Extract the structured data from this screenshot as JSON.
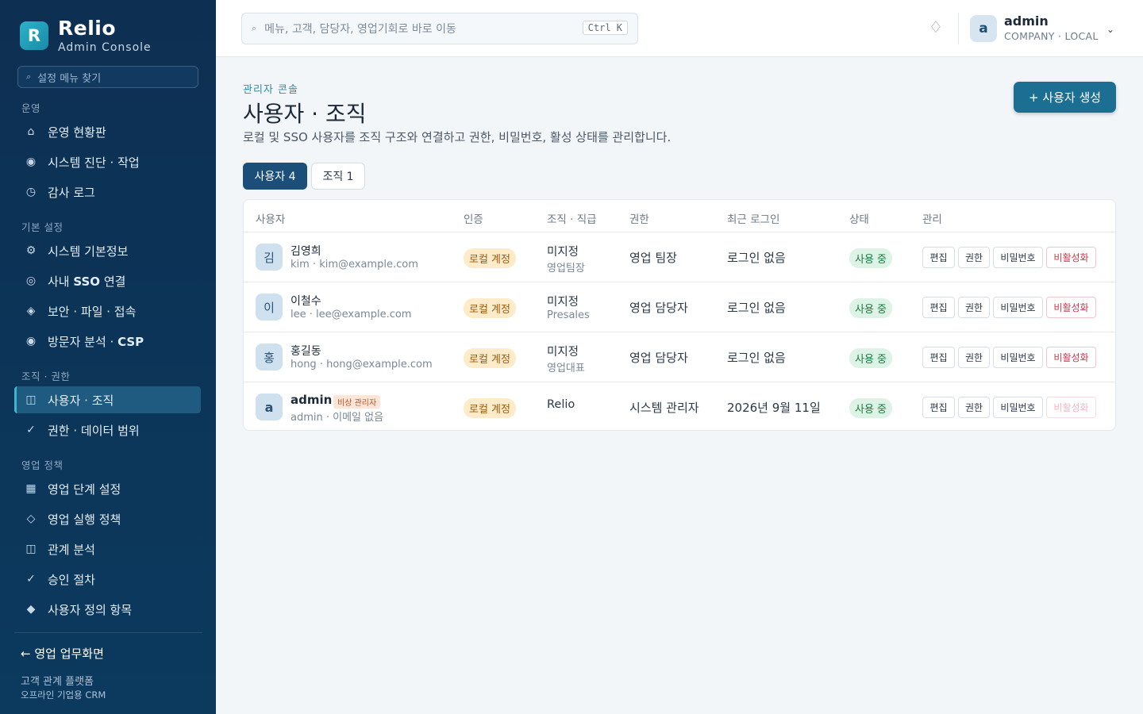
{
  "brand": {
    "logo": "R",
    "name": "Relio",
    "subtitle": "Admin Console"
  },
  "sidebar": {
    "search_placeholder": "설정 메뉴 찾기",
    "sections": [
      {
        "label": "운영",
        "items": [
          {
            "icon": "home-icon",
            "glyph": "⌂",
            "label": "운영 현황판"
          },
          {
            "icon": "diagnostics-icon",
            "glyph": "◉",
            "label": "시스템 진단 · 작업"
          },
          {
            "icon": "clock-icon",
            "glyph": "◷",
            "label": "감사 로그"
          }
        ]
      },
      {
        "label": "기본 설정",
        "items": [
          {
            "icon": "gear-icon",
            "glyph": "⚙",
            "label": "시스템 기본정보"
          },
          {
            "icon": "sso-icon",
            "glyph": "◎",
            "label_pre": "사내 ",
            "label_bold": "SSO",
            "label_post": " 연결"
          },
          {
            "icon": "security-icon",
            "glyph": "◈",
            "label": "보안 · 파일 · 접속"
          },
          {
            "icon": "analytics-icon",
            "glyph": "◉",
            "label_pre": "방문자 분석 · ",
            "label_bold": "CSP",
            "label_post": ""
          }
        ]
      },
      {
        "label": "조직 · 권한",
        "items": [
          {
            "icon": "users-icon",
            "glyph": "◫",
            "label": "사용자 · 조직",
            "active": true
          },
          {
            "icon": "check-icon",
            "glyph": "✓",
            "label": "권한 · 데이터 범위"
          }
        ]
      },
      {
        "label": "영업 정책",
        "items": [
          {
            "icon": "grid-icon",
            "glyph": "▦",
            "label": "영업 단계 설정"
          },
          {
            "icon": "diamond-outline-icon",
            "glyph": "◇",
            "label": "영업 실행 정책"
          },
          {
            "icon": "relation-icon",
            "glyph": "◫",
            "label": "관계 분석"
          },
          {
            "icon": "check-icon",
            "glyph": "✓",
            "label": "승인 절차"
          },
          {
            "icon": "diamond-icon",
            "glyph": "◆",
            "label": "사용자 정의 항목"
          }
        ]
      }
    ],
    "back_link": "← 영업 업무화면",
    "footer_line1": "고객 관계 플랫폼",
    "footer_line2": "오프라인 기업용 CRM"
  },
  "topbar": {
    "search_placeholder": "메뉴, 고객, 담당자, 영업기회로 바로 이동",
    "shortcut": "Ctrl K",
    "notify_glyph": "♢",
    "user": {
      "avatar": "a",
      "name": "admin",
      "meta": "COMPANY · LOCAL",
      "caret": "⌄"
    }
  },
  "main": {
    "eyebrow": "관리자 콘솔",
    "title": "사용자 · 조직",
    "description": "로컬 및 SSO 사용자를 조직 구조와 연결하고 권한, 비밀번호, 활성 상태를 관리합니다.",
    "create_button": "+ 사용자 생성",
    "tabs": [
      {
        "label": "사용자 4",
        "active": true
      },
      {
        "label": "조직 1",
        "active": false
      }
    ],
    "table": {
      "headers": [
        "사용자",
        "인증",
        "조직 · 직급",
        "권한",
        "최근 로그인",
        "상태",
        "관리"
      ],
      "actions": [
        "편집",
        "권한",
        "비밀번호",
        "비활성화"
      ],
      "rows": [
        {
          "avatar": "김",
          "name": "김영희",
          "sub": "kim · kim@example.com",
          "auth": "로컬 계정",
          "org": "미지정",
          "position": "영업팀장",
          "role": "영업 팀장",
          "last_login": "로그인 없음",
          "status": "사용 중"
        },
        {
          "avatar": "이",
          "name": "이철수",
          "sub": "lee · lee@example.com",
          "auth": "로컬 계정",
          "org": "미지정",
          "position": "Presales",
          "role": "영업 담당자",
          "last_login": "로그인 없음",
          "status": "사용 중"
        },
        {
          "avatar": "홍",
          "name": "홍길동",
          "sub": "hong · hong@example.com",
          "auth": "로컬 계정",
          "org": "미지정",
          "position": "영업대표",
          "role": "영업 담당자",
          "last_login": "로그인 없음",
          "status": "사용 중"
        },
        {
          "avatar": "a",
          "name": "admin",
          "badge": "비상 관리자",
          "sub": "admin · 이메일 없음",
          "auth": "로컬 계정",
          "org": "Relio",
          "position": "",
          "role": "시스템 관리자",
          "last_login": "2026년 9월 11일",
          "status": "사용 중",
          "deactivate_disabled": true
        }
      ]
    }
  },
  "colors": {
    "sidebar": "#0d2f52",
    "accent": "#1c6f93",
    "active_tab": "#1b4f7a",
    "status_green": "#1d7a45",
    "danger": "#c73b4b"
  }
}
